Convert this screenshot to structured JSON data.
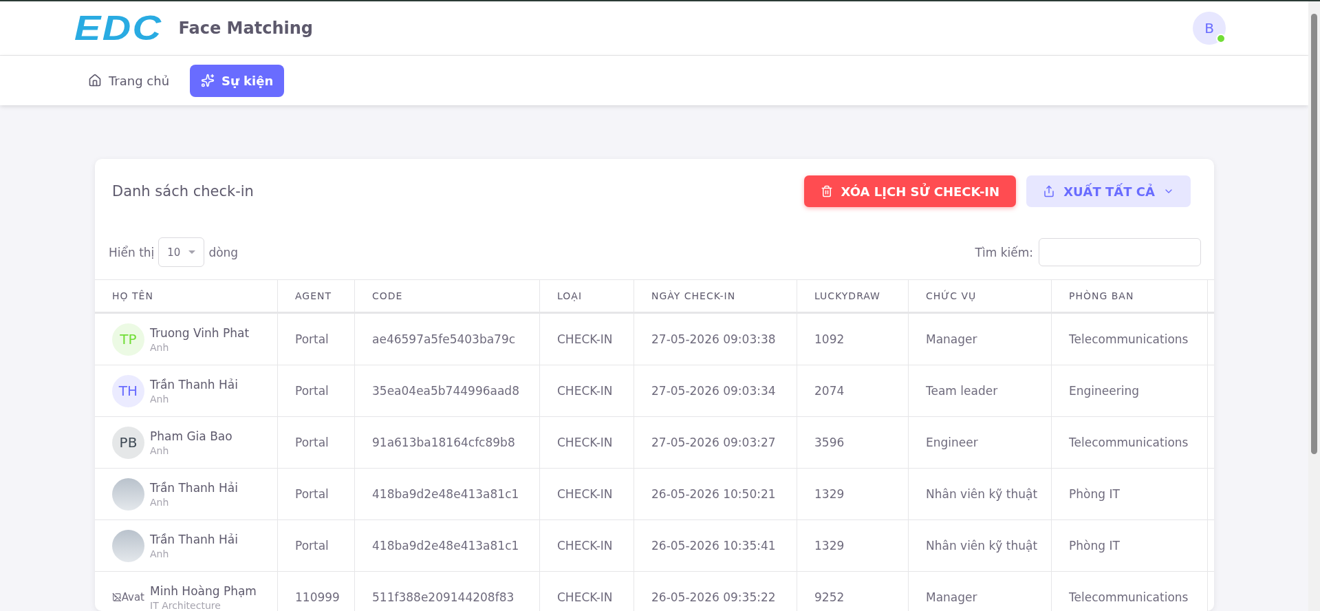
{
  "header": {
    "logo": "EDC",
    "app_name": "Face Matching",
    "user": {
      "initial": "B",
      "online": true
    }
  },
  "nav": [
    {
      "label": "Trang chủ",
      "selected": false
    },
    {
      "label": "Sự kiện",
      "selected": true
    }
  ],
  "card": {
    "title": "Danh sách check-in",
    "buttons": [
      {
        "label": "XÓA LỊCH SỬ CHECK-IN",
        "kind": "danger"
      },
      {
        "label": "XUẤT TẤT CẢ",
        "kind": "export"
      }
    ],
    "length": {
      "before": "Hiển thị",
      "value": "10",
      "after": "dòng"
    },
    "search": {
      "label": "Tìm kiếm:"
    }
  },
  "table": {
    "columns": [
      "HỌ TÊN",
      "AGENT",
      "CODE",
      "LOẠI",
      "NGÀY CHECK-IN",
      "LUCKYDRAW",
      "CHỨC VỤ",
      "PHÒNG BAN"
    ],
    "rows": [
      {
        "cells": [
          {
            "avatar": {
              "kind": "initials",
              "text": "TP",
              "color": "#71dd37"
            },
            "name": "Truong Vinh Phat",
            "subtitle": "Anh"
          },
          "Portal",
          "ae46597a5fe5403ba79c",
          "CHECK-IN",
          "27-05-2026 09:03:38",
          "1092",
          "Manager",
          "Telecommunications"
        ]
      },
      {
        "cells": [
          {
            "avatar": {
              "kind": "initials",
              "text": "TH",
              "color": "#696cff"
            },
            "name": "Trần Thanh Hải",
            "subtitle": "Anh"
          },
          "Portal",
          "35ea04ea5b744996aad8",
          "CHECK-IN",
          "27-05-2026 09:03:34",
          "2074",
          "Team leader",
          "Engineering"
        ]
      },
      {
        "cells": [
          {
            "avatar": {
              "kind": "initials",
              "text": "PB",
              "color": "#3f4a55"
            },
            "name": "Pham Gia Bao",
            "subtitle": "Anh"
          },
          "Portal",
          "91a613ba18164cfc89b8",
          "CHECK-IN",
          "27-05-2026 09:03:27",
          "3596",
          "Engineer",
          "Telecommunications"
        ]
      },
      {
        "cells": [
          {
            "avatar": {
              "kind": "photo"
            },
            "name": "Trần Thanh Hải",
            "subtitle": "Anh"
          },
          "Portal",
          "418ba9d2e48e413a81c1",
          "CHECK-IN",
          "26-05-2026 10:50:21",
          "1329",
          "Nhân viên kỹ thuật",
          "Phòng IT"
        ]
      },
      {
        "cells": [
          {
            "avatar": {
              "kind": "photo"
            },
            "name": "Trần Thanh Hải",
            "subtitle": "Anh"
          },
          "Portal",
          "418ba9d2e48e413a81c1",
          "CHECK-IN",
          "26-05-2026 10:35:41",
          "1329",
          "Nhân viên kỹ thuật",
          "Phòng IT"
        ]
      },
      {
        "cells": [
          {
            "avatar": {
              "kind": "broken",
              "text": "Avat"
            },
            "name": "Minh Hoàng Phạm",
            "subtitle": "IT Architecture"
          },
          "110999",
          "511f388e209144208f83",
          "CHECK-IN",
          "26-05-2026 09:35:22",
          "9252",
          "Manager",
          "Telecommunications"
        ]
      }
    ]
  }
}
